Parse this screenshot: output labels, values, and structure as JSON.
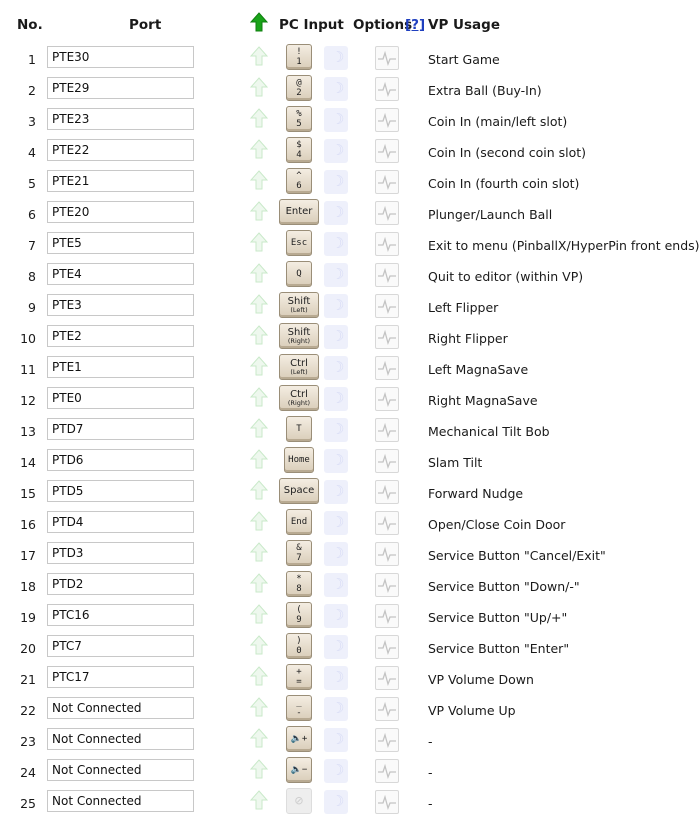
{
  "header": {
    "no": "No.",
    "port": "Port",
    "pc_input": "PC Input",
    "options": "Options",
    "help": "[?]",
    "vp_usage": "VP Usage"
  },
  "rows": [
    {
      "no": "1",
      "port": "PTE30",
      "key": [
        "!",
        "1"
      ],
      "usage": "Start Game"
    },
    {
      "no": "2",
      "port": "PTE29",
      "key": [
        "@",
        "2"
      ],
      "usage": "Extra Ball (Buy-In)"
    },
    {
      "no": "3",
      "port": "PTE23",
      "key": [
        "%",
        "5"
      ],
      "usage": "Coin In (main/left slot)"
    },
    {
      "no": "4",
      "port": "PTE22",
      "key": [
        "$",
        "4"
      ],
      "usage": "Coin In (second coin slot)"
    },
    {
      "no": "5",
      "port": "PTE21",
      "key": [
        "^",
        "6"
      ],
      "usage": "Coin In (fourth coin slot)"
    },
    {
      "no": "6",
      "port": "PTE20",
      "key": [
        "Enter"
      ],
      "wide": true,
      "usage": "Plunger/Launch Ball"
    },
    {
      "no": "7",
      "port": "PTE5",
      "key": [
        "Esc"
      ],
      "usage": "Exit to menu (PinballX/HyperPin front ends)"
    },
    {
      "no": "8",
      "port": "PTE4",
      "key": [
        "Q"
      ],
      "usage": "Quit to editor (within VP)"
    },
    {
      "no": "9",
      "port": "PTE3",
      "key": [
        "Shift",
        "(Left)"
      ],
      "wide": true,
      "usage": "Left Flipper"
    },
    {
      "no": "10",
      "port": "PTE2",
      "key": [
        "Shift",
        "(Right)"
      ],
      "wide": true,
      "usage": "Right Flipper"
    },
    {
      "no": "11",
      "port": "PTE1",
      "key": [
        "Ctrl",
        "(Left)"
      ],
      "wide": true,
      "usage": "Left MagnaSave"
    },
    {
      "no": "12",
      "port": "PTE0",
      "key": [
        "Ctrl",
        "(Right)"
      ],
      "wide": true,
      "usage": "Right MagnaSave"
    },
    {
      "no": "13",
      "port": "PTD7",
      "key": [
        "T"
      ],
      "usage": "Mechanical Tilt Bob"
    },
    {
      "no": "14",
      "port": "PTD6",
      "key": [
        "Home"
      ],
      "usage": "Slam Tilt"
    },
    {
      "no": "15",
      "port": "PTD5",
      "key": [
        "Space"
      ],
      "wide": true,
      "usage": "Forward Nudge"
    },
    {
      "no": "16",
      "port": "PTD4",
      "key": [
        "End"
      ],
      "usage": "Open/Close Coin Door"
    },
    {
      "no": "17",
      "port": "PTD3",
      "key": [
        "&",
        "7"
      ],
      "usage": "Service Button \"Cancel/Exit\""
    },
    {
      "no": "18",
      "port": "PTD2",
      "key": [
        "*",
        "8"
      ],
      "usage": "Service Button \"Down/-\""
    },
    {
      "no": "19",
      "port": "PTC16",
      "key": [
        "(",
        "9"
      ],
      "usage": "Service Button \"Up/+\""
    },
    {
      "no": "20",
      "port": "PTC7",
      "key": [
        ")",
        "0"
      ],
      "usage": "Service Button \"Enter\""
    },
    {
      "no": "21",
      "port": "PTC17",
      "key": [
        "+",
        "="
      ],
      "usage": "VP Volume Down"
    },
    {
      "no": "22",
      "port": "Not Connected",
      "key": [
        "_",
        "-"
      ],
      "usage": "VP Volume Up"
    },
    {
      "no": "23",
      "port": "Not Connected",
      "key": [
        "🔈+"
      ],
      "usage": "-"
    },
    {
      "no": "24",
      "port": "Not Connected",
      "key": [
        "🔈−"
      ],
      "usage": "-"
    },
    {
      "no": "25",
      "port": "Not Connected",
      "key": [
        "⊘"
      ],
      "disabled": true,
      "usage": "-"
    }
  ],
  "icons": {
    "arrow_header": "green-up-arrow-icon",
    "arrow_row": "pale-green-up-arrow-icon",
    "option_shift": "moon-icon",
    "option_pulse": "pulse-icon"
  },
  "colors": {
    "arrow_active": "#19a319",
    "arrow_inactive": "#c9e9c9",
    "help_link": "#1f3fbf"
  }
}
